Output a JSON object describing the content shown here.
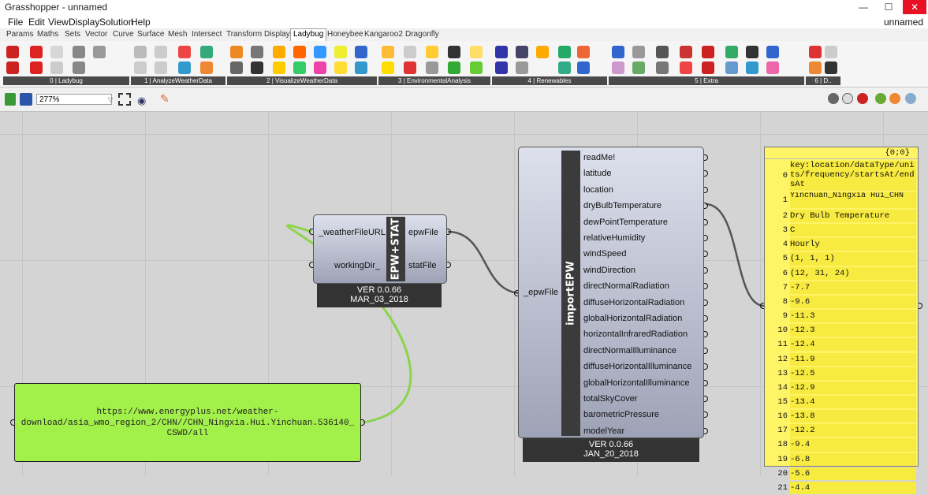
{
  "window": {
    "title": "Grasshopper - unnamed",
    "doc_name": "unnamed",
    "minimize": "—",
    "maximize": "☐",
    "close": "✕"
  },
  "menu": [
    "File",
    "Edit",
    "View",
    "Display",
    "Solution",
    "Help"
  ],
  "tabs": [
    "Params",
    "Maths",
    "Sets",
    "Vector",
    "Curve",
    "Surface",
    "Mesh",
    "Intersect",
    "Transform",
    "Display",
    "Ladybug",
    "Honeybee",
    "Kangaroo2",
    "Dragonfly"
  ],
  "active_tab": "Ladybug",
  "ribbon_groups": [
    "0 | Ladybug",
    "1 | AnalyzeWeatherData",
    "2 | VisualizeWeatherData",
    "3 | EnvironmentalAnalysis",
    "4 | Renewables",
    "5 | Extra",
    "6 | D.."
  ],
  "toolbar": {
    "zoom": "277%"
  },
  "components": {
    "epw_stat": {
      "inputs": [
        "_weatherFileURL",
        "workingDir_"
      ],
      "nickname": "EPW+STAT",
      "outputs": [
        "epwFile",
        "statFile"
      ],
      "version": "VER 0.0.66",
      "date": "MAR_03_2018"
    },
    "import_epw": {
      "input": "_epwFile",
      "nickname": "importEPW",
      "outputs": [
        "readMe!",
        "latitude",
        "location",
        "dryBulbTemperature",
        "dewPointTemperature",
        "relativeHumidity",
        "windSpeed",
        "windDirection",
        "directNormalRadiation",
        "diffuseHorizontalRadiation",
        "globalHorizontalRadiation",
        "horizontalInfraredRadiation",
        "directNormalIlluminance",
        "diffuseHorizontalIlluminance",
        "globalHorizontalIlluminance",
        "totalSkyCover",
        "barometricPressure",
        "modelYear"
      ],
      "version": "VER 0.0.66",
      "date": "JAN_20_2018"
    }
  },
  "panel": {
    "lines": [
      "https://www.energyplus.net/weather-",
      "download/asia_wmo_region_2/CHN//CHN_Ningxia.Hui.Yinchuan.536140_",
      "CSWD/all"
    ]
  },
  "viewer": {
    "path": "{0;0}",
    "rows": [
      {
        "i": "0",
        "v": "key:location/dataType/units/frequency/startsAt/endsAt"
      },
      {
        "i": "1",
        "v": "Yinchuan_Ningxia Hui_CHN"
      },
      {
        "i": "2",
        "v": "Dry Bulb Temperature"
      },
      {
        "i": "3",
        "v": "C"
      },
      {
        "i": "4",
        "v": "Hourly"
      },
      {
        "i": "5",
        "v": "(1, 1, 1)"
      },
      {
        "i": "6",
        "v": "(12, 31, 24)"
      },
      {
        "i": "7",
        "v": "-7.7"
      },
      {
        "i": "8",
        "v": "-9.6"
      },
      {
        "i": "9",
        "v": "-11.3"
      },
      {
        "i": "10",
        "v": "-12.3"
      },
      {
        "i": "11",
        "v": "-12.4"
      },
      {
        "i": "12",
        "v": "-11.9"
      },
      {
        "i": "13",
        "v": "-12.5"
      },
      {
        "i": "14",
        "v": "-12.9"
      },
      {
        "i": "15",
        "v": "-13.4"
      },
      {
        "i": "16",
        "v": "-13.8"
      },
      {
        "i": "17",
        "v": "-12.2"
      },
      {
        "i": "18",
        "v": "-9.4"
      },
      {
        "i": "19",
        "v": "-6.8"
      },
      {
        "i": "20",
        "v": "-5.6"
      },
      {
        "i": "21",
        "v": "-4.4"
      }
    ]
  },
  "colors": {
    "panel_green": "#a2f04a",
    "viewer_yellow": "#fff466",
    "wire_green": "#8bd44a"
  }
}
